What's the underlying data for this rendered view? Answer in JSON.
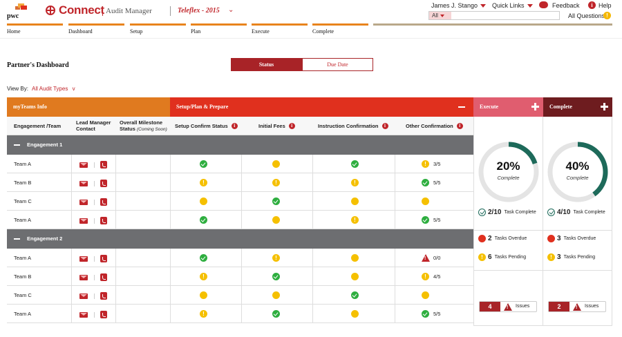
{
  "header": {
    "brand_logo_text": "pwc",
    "app_name": "Connect",
    "app_sub": "Audit Manager",
    "client": "Teleflex - 2015",
    "user": "James J. Stango",
    "quick_links": "Quick Links",
    "feedback": "Feedback",
    "help": "Help",
    "search_scope": "All",
    "search_placeholder": "",
    "all_questions": "All Questions",
    "help_glyph": "i",
    "questions_glyph": "!"
  },
  "nav": [
    "Home",
    "Dashboard",
    "Setup",
    "Plan",
    "Execute",
    "Complete"
  ],
  "page": {
    "title": "Partner's Dashboard",
    "tab_status": "Status",
    "tab_due": "Due Date",
    "view_by_label": "View By:",
    "view_by_value": "All Audit Types",
    "view_by_chevron": "v"
  },
  "bands": {
    "teams": "myTeams Info",
    "setup": "Setup/Plan & Prepare",
    "execute": "Execute",
    "complete": "Complete"
  },
  "columns": {
    "team": "Engagement /Team",
    "lead": "Lead Manager Contact",
    "milestone": "Overall Milestone Status",
    "milestone_note": "(Coming Soon)",
    "setup_confirm": "Setup Confirm Status",
    "initial_fees": "Initial Fees",
    "instruction": "Instruction Confirmation",
    "other": "Other Confirmation",
    "info_glyph": "i"
  },
  "engagements": [
    {
      "name": "Engagement 1",
      "rows": [
        {
          "team": "Team A",
          "setup": "ok",
          "fees": "pending",
          "instr": "ok",
          "other": "warn",
          "other_frac": "3/5"
        },
        {
          "team": "Team B",
          "setup": "warn",
          "fees": "warn",
          "instr": "warn",
          "other": "ok",
          "other_frac": "5/5"
        },
        {
          "team": "Team C",
          "setup": "pending",
          "fees": "ok",
          "instr": "pending",
          "other": "pending",
          "other_frac": ""
        },
        {
          "team": "Team A",
          "setup": "ok",
          "fees": "pending",
          "instr": "warn",
          "other": "ok",
          "other_frac": "5/5"
        }
      ]
    },
    {
      "name": "Engagement 2",
      "rows": [
        {
          "team": "Team A",
          "setup": "ok",
          "fees": "warn",
          "instr": "pending",
          "other": "alert",
          "other_frac": "0/0"
        },
        {
          "team": "Team B",
          "setup": "warn",
          "fees": "ok",
          "instr": "pending",
          "other": "warn",
          "other_frac": "4/5"
        },
        {
          "team": "Team C",
          "setup": "pending",
          "fees": "pending",
          "instr": "ok",
          "other": "pending",
          "other_frac": ""
        },
        {
          "team": "Team A",
          "setup": "warn",
          "fees": "ok",
          "instr": "pending",
          "other": "ok",
          "other_frac": "5/5"
        }
      ]
    }
  ],
  "summary": {
    "execute": {
      "percent": "20%",
      "percent_value": 0.2,
      "percent_label": "Complete",
      "tasks_complete": "2/10",
      "tasks_complete_label": "Task Complete",
      "overdue": "2",
      "overdue_label": "Tasks Overdue",
      "pending": "6",
      "pending_label": "Tasks Pending",
      "issues": "4",
      "issues_label": "Issues"
    },
    "complete": {
      "percent": "40%",
      "percent_value": 0.4,
      "percent_label": "Complete",
      "tasks_complete": "4/10",
      "tasks_complete_label": "Task Complete",
      "overdue": "3",
      "overdue_label": "Tasks Overdue",
      "pending": "3",
      "pending_label": "Tasks Pending",
      "issues": "2",
      "issues_label": "Issues"
    }
  },
  "glyphs": {
    "warn": "!"
  },
  "colors": {
    "brand_red": "#c0252a",
    "teams_band": "#e07a1f",
    "setup_band": "#e0301e",
    "execute_band": "#e05d6f",
    "complete_band": "#6e1c1f",
    "ring_fill": "#1d6a5a",
    "ring_track": "#e4e4e4",
    "ok": "#2eae3f",
    "pending": "#f5c000",
    "engagement_row": "#6d6e71"
  }
}
